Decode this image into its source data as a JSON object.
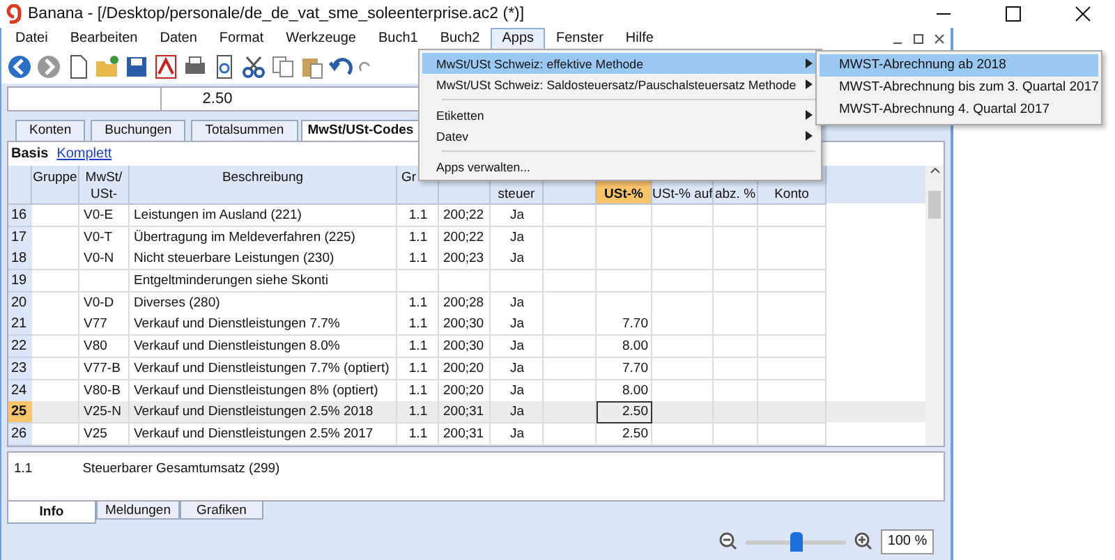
{
  "window": {
    "title": "Banana - [/Desktop/personale/de_de_vat_sme_soleenterprise.ac2 (*)]"
  },
  "menu": [
    {
      "label": "Datei",
      "selected": false
    },
    {
      "label": "Bearbeiten",
      "selected": false
    },
    {
      "label": "Daten",
      "selected": false
    },
    {
      "label": "Format",
      "selected": false
    },
    {
      "label": "Werkzeuge",
      "selected": false
    },
    {
      "label": "Buch1",
      "selected": false
    },
    {
      "label": "Buch2",
      "selected": false
    },
    {
      "label": "Apps",
      "selected": true
    },
    {
      "label": "Fenster",
      "selected": false
    },
    {
      "label": "Hilfe",
      "selected": false
    }
  ],
  "formula_bar": {
    "value": "2.50"
  },
  "tabs": [
    {
      "label": "Konten",
      "selected": false
    },
    {
      "label": "Buchungen",
      "selected": false
    },
    {
      "label": "Totalsummen",
      "selected": false
    },
    {
      "label": "MwSt/USt-Codes",
      "selected": true
    }
  ],
  "views": [
    {
      "label": "Basis",
      "selected": true
    },
    {
      "label": "Komplett",
      "selected": false
    }
  ],
  "table": {
    "columns": [
      {
        "kind": "top",
        "selected": false
      },
      {
        "label": "Gruppe",
        "kind": "top",
        "selected": false
      },
      {
        "label": "MwSt/ USt-",
        "kind": "top",
        "selected": false
      },
      {
        "label": "Beschreibung",
        "kind": "top",
        "selected": false
      },
      {
        "label": "Gr",
        "kind": "top-left",
        "selected": false
      },
      {
        "kind": "bottom",
        "selected": false
      },
      {
        "label": "steuer",
        "kind": "bottom",
        "selected": false
      },
      {
        "kind": "bottom",
        "selected": false
      },
      {
        "label": "USt-%",
        "kind": "bottom",
        "selected": true
      },
      {
        "label": "USt-% auf",
        "kind": "bottom",
        "selected": false
      },
      {
        "label": "abz. %",
        "kind": "bottom",
        "selected": false
      },
      {
        "label": "Konto",
        "kind": "bottom",
        "selected": false
      }
    ],
    "rows": [
      {
        "selected": false,
        "cells": [
          "16",
          null,
          "V0-E",
          "Leistungen im Ausland (221)",
          "1.1",
          "200;22",
          "Ja",
          null,
          null,
          null,
          null,
          null
        ]
      },
      {
        "selected": false,
        "cells": [
          "17",
          null,
          "V0-T",
          "Übertragung im Meldeverfahren (225)",
          "1.1",
          "200;22",
          "Ja",
          null,
          null,
          null,
          null,
          null
        ]
      },
      {
        "selected": false,
        "cells": [
          "18",
          null,
          "V0-N",
          "Nicht steuerbare Leistungen (230)",
          "1.1",
          "200;23",
          "Ja",
          null,
          null,
          null,
          null,
          null
        ]
      },
      {
        "selected": false,
        "cells": [
          "19",
          null,
          null,
          "Entgeltminderungen siehe Skonti",
          null,
          null,
          null,
          null,
          null,
          null,
          null,
          null
        ]
      },
      {
        "selected": false,
        "cells": [
          "20",
          null,
          "V0-D",
          "Diverses (280)",
          "1.1",
          "200;28",
          "Ja",
          null,
          null,
          null,
          null,
          null
        ]
      },
      {
        "selected": false,
        "cells": [
          "21",
          null,
          "V77",
          "Verkauf und Dienstleistungen 7.7%",
          "1.1",
          "200;30",
          "Ja",
          null,
          "7.70",
          null,
          null,
          null
        ]
      },
      {
        "selected": false,
        "cells": [
          "22",
          null,
          "V80",
          "Verkauf und Dienstleistungen 8.0%",
          "1.1",
          "200;30",
          "Ja",
          null,
          "8.00",
          null,
          null,
          null
        ]
      },
      {
        "selected": false,
        "cells": [
          "23",
          null,
          "V77-B",
          "Verkauf und Dienstleistungen 7.7% (optiert)",
          "1.1",
          "200;20",
          "Ja",
          null,
          "7.70",
          null,
          null,
          null
        ]
      },
      {
        "selected": false,
        "cells": [
          "24",
          null,
          "V80-B",
          "Verkauf und Dienstleistungen 8% (optiert)",
          "1.1",
          "200;20",
          "Ja",
          null,
          "8.00",
          null,
          null,
          null
        ]
      },
      {
        "selected": true,
        "cells": [
          "25",
          null,
          "V25-N",
          "Verkauf und Dienstleistungen 2.5% 2018",
          "1.1",
          "200;31",
          "Ja",
          null,
          "2.50",
          null,
          null,
          null
        ]
      },
      {
        "selected": false,
        "cells": [
          "26",
          null,
          "V25",
          "Verkauf und Dienstleistungen 2.5% 2017",
          "1.1",
          "200;31",
          "Ja",
          null,
          "2.50",
          null,
          null,
          null
        ]
      }
    ]
  },
  "info": {
    "group": "1.1",
    "text": "Steuerbarer Gesamtumsatz (299)"
  },
  "bottom_tabs": [
    {
      "label": "Info",
      "selected": true
    },
    {
      "label": "Meldungen",
      "selected": false
    },
    {
      "label": "Grafiken",
      "selected": false
    }
  ],
  "zoom": {
    "level": 0.5,
    "value": "100 %"
  },
  "apps_menu": [
    {
      "label": "MwSt/USt Schweiz: effektive Methode",
      "submenu": true,
      "selected": true,
      "separator_after": false
    },
    {
      "label": "MwSt/USt Schweiz: Saldosteuersatz/Pauschalsteuersatz Methode",
      "submenu": true,
      "selected": false,
      "separator_after": true
    },
    {
      "label": "Etiketten",
      "submenu": true,
      "selected": false,
      "separator_after": false
    },
    {
      "label": "Datev",
      "submenu": true,
      "selected": false,
      "separator_after": true
    },
    {
      "label": "Apps verwalten...",
      "submenu": false,
      "selected": false,
      "separator_after": false
    }
  ],
  "submenu": [
    {
      "label": "MWST-Abrechnung ab 2018",
      "selected": true
    },
    {
      "label": "MWST-Abrechnung bis zum 3. Quartal 2017",
      "selected": false
    },
    {
      "label": "MWST-Abrechnung 4. Quartal 2017",
      "selected": false
    }
  ]
}
